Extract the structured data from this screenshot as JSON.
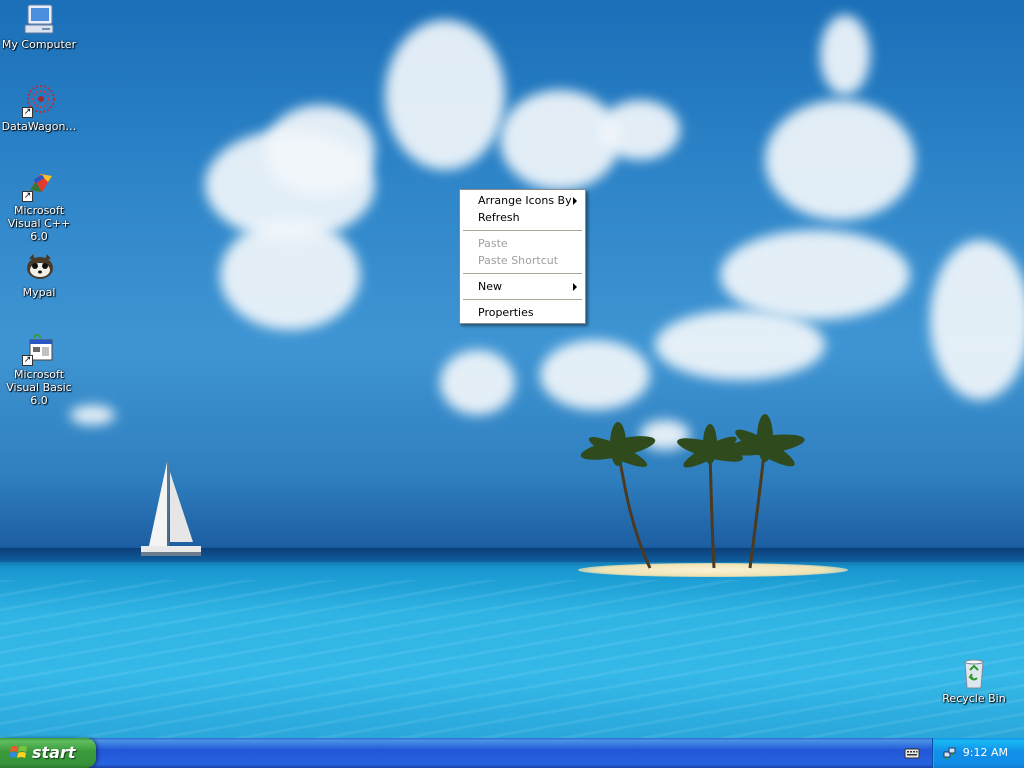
{
  "desktop": {
    "icons": [
      {
        "label": "My Computer",
        "icon": "my-computer-icon"
      },
      {
        "label": "DataWagon…",
        "icon": "datawagon-icon"
      },
      {
        "label": "Microsoft Visual C++ 6.0",
        "icon": "visual-cpp-icon"
      },
      {
        "label": "Mypal",
        "icon": "mypal-icon"
      },
      {
        "label": "Microsoft Visual Basic 6.0",
        "icon": "visual-basic-icon"
      },
      {
        "label": "Recycle Bin",
        "icon": "recycle-bin-icon"
      }
    ]
  },
  "context_menu": {
    "items": [
      {
        "label": "Arrange Icons By",
        "enabled": true,
        "submenu": true
      },
      {
        "label": "Refresh",
        "enabled": true
      },
      {
        "label": "Paste",
        "enabled": false
      },
      {
        "label": "Paste Shortcut",
        "enabled": false
      },
      {
        "label": "New",
        "enabled": true,
        "submenu": true
      },
      {
        "label": "Properties",
        "enabled": true
      }
    ]
  },
  "taskbar": {
    "start_label": "start",
    "clock": "9:12 AM",
    "tray_icons": [
      "keyboard-icon",
      "network-icon"
    ]
  },
  "colors": {
    "taskbar_blue": "#2157d7",
    "start_green": "#3a9a3a",
    "tray_blue": "#1290e9"
  }
}
